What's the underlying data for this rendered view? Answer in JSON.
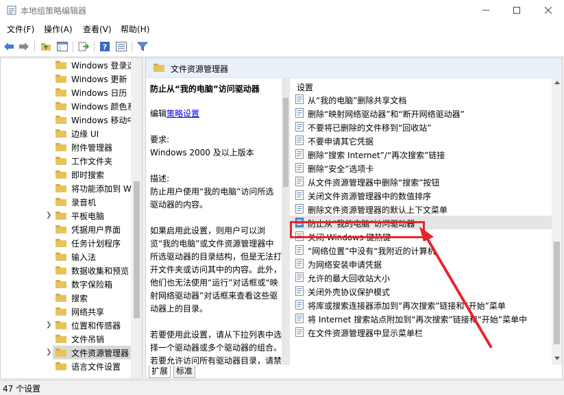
{
  "window": {
    "title": "本地组策略编辑器"
  },
  "menu": [
    "文件(F)",
    "操作(A)",
    "查看(V)",
    "帮助(H)"
  ],
  "tree": {
    "items": [
      {
        "label": "Windows 登录选",
        "expander": false,
        "selected": false
      },
      {
        "label": "Windows 更新",
        "expander": false,
        "selected": false
      },
      {
        "label": "Windows 日历",
        "expander": false,
        "selected": false
      },
      {
        "label": "Windows 颜色系",
        "expander": false,
        "selected": false
      },
      {
        "label": "Windows 移动中",
        "expander": false,
        "selected": false
      },
      {
        "label": "边缘 UI",
        "expander": false,
        "selected": false
      },
      {
        "label": "附件管理器",
        "expander": false,
        "selected": false
      },
      {
        "label": "工作文件夹",
        "expander": false,
        "selected": false
      },
      {
        "label": "即时搜索",
        "expander": false,
        "selected": false
      },
      {
        "label": "将功能添加到 W",
        "expander": false,
        "selected": false
      },
      {
        "label": "录音机",
        "expander": false,
        "selected": false
      },
      {
        "label": "平板电脑",
        "expander": true,
        "selected": false
      },
      {
        "label": "凭据用户界面",
        "expander": false,
        "selected": false
      },
      {
        "label": "任务计划程序",
        "expander": false,
        "selected": false
      },
      {
        "label": "输入法",
        "expander": false,
        "selected": false
      },
      {
        "label": "数据收集和预览",
        "expander": false,
        "selected": false
      },
      {
        "label": "数字保险箱",
        "expander": false,
        "selected": false
      },
      {
        "label": "搜索",
        "expander": false,
        "selected": false
      },
      {
        "label": "网络共享",
        "expander": false,
        "selected": false
      },
      {
        "label": "位置和传感器",
        "expander": true,
        "selected": false
      },
      {
        "label": "文件吊销",
        "expander": false,
        "selected": false
      },
      {
        "label": "文件资源管理器",
        "expander": true,
        "selected": true
      },
      {
        "label": "语言文件设置",
        "expander": false,
        "selected": false
      }
    ]
  },
  "panel": {
    "header": "文件资源管理器",
    "desc": {
      "title": "防止从“我的电脑”访问驱动器",
      "edit_prefix": "编辑",
      "edit_link": "策略设置",
      "req_label": "要求:",
      "req_value": "Windows 2000 及以上版本",
      "desc_label": "描述:",
      "desc_text": "防止用户使用“我的电脑”访问所选驱动器的内容。",
      "para1": "如果启用此设置，则用户可以浏览“我的电脑”或文件资源管理器中所选驱动器的目录结构，但是无法打开文件夹或访问其中的内容。此外，他们也无法使用“运行”对话框或“映射网络驱动器”对话框来查看这些驱动器上的目录。",
      "para2": "若要使用此设置，请从下拉列表中选择一个驱动器或多个驱动器的组合。若要允许访问所有驱动器目录，请禁用此设置或从下拉列表中选择“不限制驱动器”选项。"
    },
    "column_header": "设置",
    "settings": [
      "从“我的电脑”删除共享文档",
      "删除“映射网络驱动器”和“断开网络驱动器”",
      "不要将已删除的文件移到“回收站”",
      "不要申请其它凭据",
      "删除“搜索 Internet”/“再次搜索”链接",
      "删除“安全”选项卡",
      "从文件资源管理器中删除“搜索”按钮",
      "关闭文件资源管理器中的数值排序",
      "删除文件资源管理器的默认上下文菜单",
      "防止从“我的电脑”访问驱动器",
      "关闭 Windows 键热键",
      "“网络位置”中没有“我附近的计算机",
      "为网络安装申请凭据",
      "允许的最大回收站大小",
      "关闭外壳协议保护模式",
      "将库或搜索连接器添加到“再次搜索”链接和“开始”菜单",
      "将 Internet 搜索站点附加到“再次搜索”链接和“开始”菜单中",
      "在文件资源管理器中显示菜单栏"
    ],
    "selected_setting": "防止从“我的电脑”访问驱动器",
    "tabs": [
      "扩展",
      "标准"
    ]
  },
  "status": {
    "text": "47 个设置"
  },
  "colors": {
    "highlight": "#e8252a",
    "header_bg": "#e9f0f8",
    "folder": "#e8c25a"
  }
}
